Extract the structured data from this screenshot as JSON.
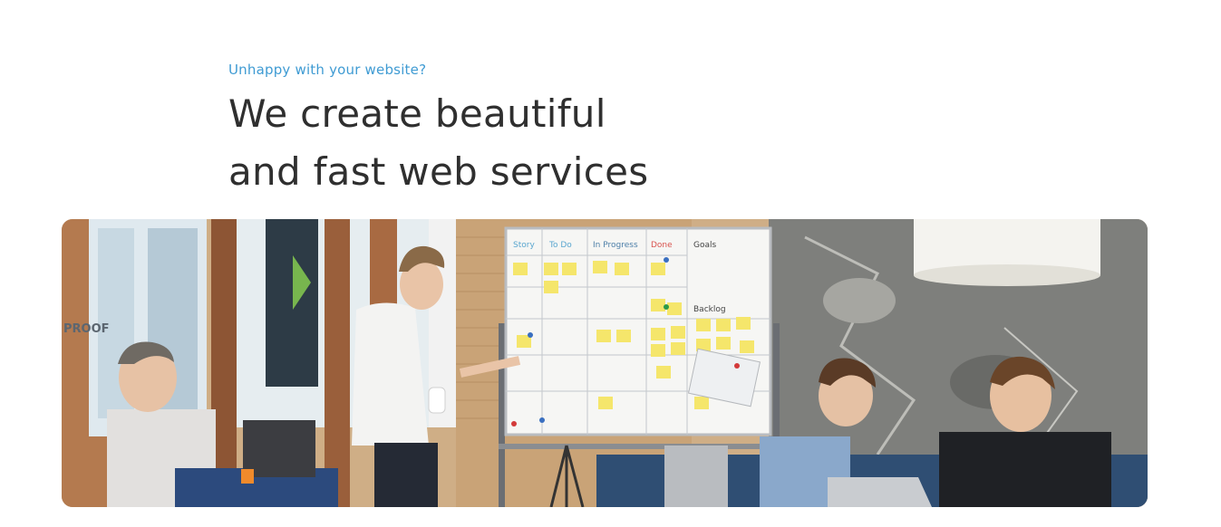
{
  "hero": {
    "eyebrow": "Unhappy with your website?",
    "headline_line1": "We create beautiful",
    "headline_line2": "and fast web services"
  },
  "photo": {
    "whiteboard_columns": [
      "Story",
      "To Do",
      "In Progress",
      "Done",
      "Goals"
    ],
    "whiteboard_backlog": "Backlog",
    "window_sign": "PROOF"
  },
  "colors": {
    "accent": "#3f9bd3",
    "headline": "#2f2f2f",
    "background": "#ffffff"
  }
}
